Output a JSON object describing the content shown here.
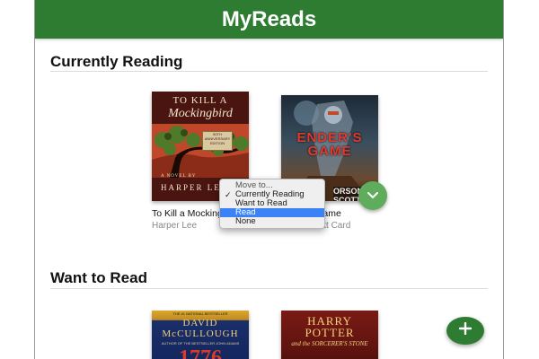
{
  "app": {
    "title": "MyReads"
  },
  "shelves": [
    {
      "title": "Currently Reading",
      "books": [
        {
          "title": "To Kill a Mockingbird",
          "author": "Harper Lee",
          "cover": {
            "line1": "TO KILL A",
            "line2": "Mockingbird",
            "badge": "50TH ANNIVERSARY EDITION",
            "novel": "A NOVEL BY",
            "author": "HARPER LEE"
          }
        },
        {
          "title": "Ender's Game",
          "author": "Orson Scott Card",
          "cover": {
            "title": "ENDER'S GAME",
            "author": "ORSON SCOTT CARD"
          }
        }
      ]
    },
    {
      "title": "Want to Read",
      "books": [
        {
          "cover": {
            "top": "THE #1 NATIONAL BESTSELLER",
            "name": "DAVID McCULLOUGH",
            "sub": "AUTHOR OF THE BESTSELLER JOHN ADAMS",
            "year": "1776"
          }
        },
        {
          "cover": {
            "name": "HARRY POTTER",
            "sub": "and the SORCERER'S STONE"
          }
        }
      ]
    }
  ],
  "shelf_menu": {
    "header": "Move to...",
    "options": [
      "Currently Reading",
      "Want to Read",
      "Read",
      "None"
    ],
    "checked": "Currently Reading",
    "highlighted": "Read"
  },
  "icons": {
    "shelf_changer": "chevron-down-icon",
    "add": "plus-icon"
  },
  "colors": {
    "header_bg": "#2e7c31",
    "changer_bg": "#60ac5d",
    "fab_bg": "#2e7c31",
    "menu_highlight": "#3b82f6"
  }
}
